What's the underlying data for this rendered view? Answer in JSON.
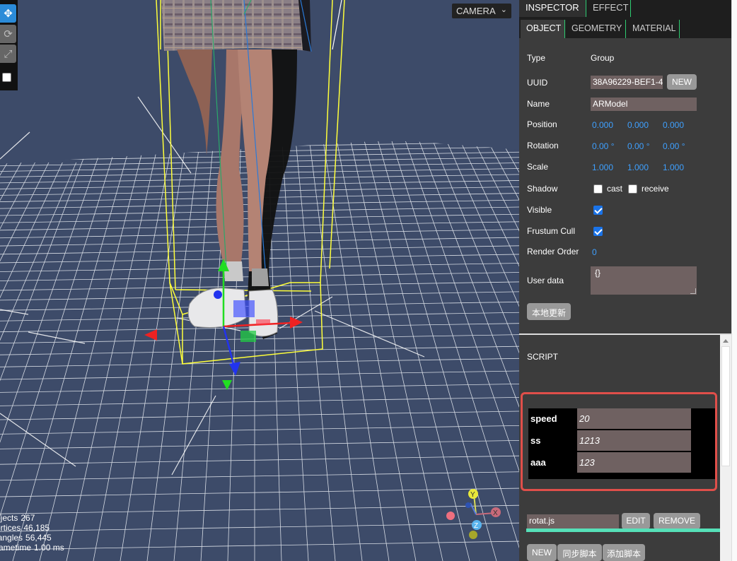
{
  "toolbar": {
    "tools": [
      "move-icon",
      "rotate-icon",
      "scale-icon"
    ],
    "local_checkbox_checked": false
  },
  "viewport": {
    "camera_select": "CAMERA",
    "info": [
      {
        "label": "bjects",
        "value": "267"
      },
      {
        "label": "ertices",
        "value": "46,185"
      },
      {
        "label": "iangles",
        "value": "56,445"
      },
      {
        "label": "rametime",
        "value": "1.00 ms"
      }
    ]
  },
  "tabs": {
    "inspector": "INSPECTOR",
    "effect": "EFFECT"
  },
  "subtabs": {
    "object": "OBJECT",
    "geometry": "GEOMETRY",
    "material": "MATERIAL"
  },
  "object": {
    "type_label": "Type",
    "type_value": "Group",
    "uuid_label": "UUID",
    "uuid_value": "38A96229-BEF1-4",
    "new_label": "NEW",
    "name_label": "Name",
    "name_value": "ARModel",
    "position_label": "Position",
    "position": [
      "0.000",
      "0.000",
      "0.000"
    ],
    "rotation_label": "Rotation",
    "rotation": [
      "0.00 °",
      "0.00 °",
      "0.00 °"
    ],
    "scale_label": "Scale",
    "scale": [
      "1.000",
      "1.000",
      "1.000"
    ],
    "shadow_label": "Shadow",
    "cast_label": "cast",
    "receive_label": "receive",
    "cast_checked": false,
    "receive_checked": false,
    "visible_label": "Visible",
    "visible_checked": true,
    "frustum_label": "Frustum Cull",
    "frustum_checked": true,
    "render_order_label": "Render Order",
    "render_order_value": "0",
    "user_data_label": "User data",
    "user_data_value": "{}",
    "local_update_label": "本地更新"
  },
  "script": {
    "title": "SCRIPT",
    "params": [
      {
        "name": "speed",
        "value": "20"
      },
      {
        "name": "ss",
        "value": "1213"
      },
      {
        "name": "aaa",
        "value": "123"
      }
    ],
    "file_name": "rotat.js",
    "edit_label": "EDIT",
    "remove_label": "REMOVE",
    "new_label": "NEW",
    "sync_label": "同步脚本",
    "add_label": "添加脚本"
  },
  "colors": {
    "highlight": "#e04f4a",
    "accent_blue": "#3ea0ff",
    "tab_border_green": "#2ecc71",
    "progress_teal": "#56e0b8"
  }
}
